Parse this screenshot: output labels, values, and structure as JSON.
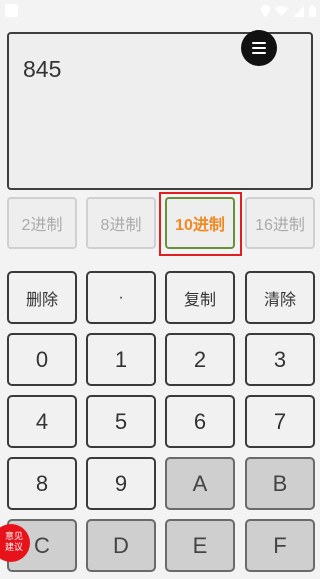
{
  "display": {
    "value": "845"
  },
  "base_tabs": [
    {
      "label": "2进制",
      "active": false
    },
    {
      "label": "8进制",
      "active": false
    },
    {
      "label": "10进制",
      "active": true
    },
    {
      "label": "16进制",
      "active": false
    }
  ],
  "commands": {
    "delete": "删除",
    "dot": "·",
    "copy": "复制",
    "clear": "清除"
  },
  "keys": {
    "k0": "0",
    "k1": "1",
    "k2": "2",
    "k3": "3",
    "k4": "4",
    "k5": "5",
    "k6": "6",
    "k7": "7",
    "k8": "8",
    "k9": "9",
    "kA": "A",
    "kB": "B",
    "kC": "C",
    "kD": "D",
    "kE": "E",
    "kF": "F"
  },
  "feedback": {
    "line1": "意见",
    "line2": "建议"
  },
  "colors": {
    "active_tab_text": "#f08a24",
    "active_tab_border": "#6a8f3b",
    "highlight": "#e02020",
    "feedback_bg": "#e8131a",
    "hex_key_bg": "#cfcfcf"
  },
  "icons": {
    "menu": "menu-icon",
    "status": [
      "location-icon",
      "wifi-icon",
      "signal-icon",
      "battery-icon"
    ]
  }
}
